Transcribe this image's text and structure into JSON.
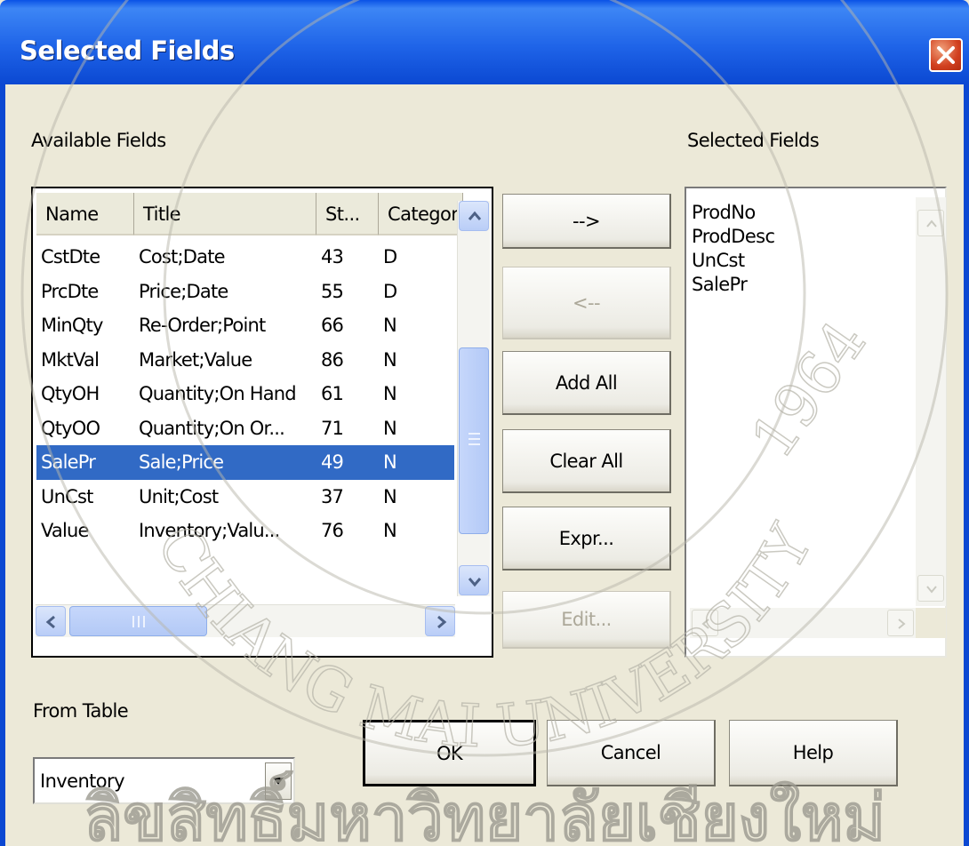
{
  "window": {
    "title": "Selected Fields"
  },
  "labels": {
    "available_fields": "Available Fields",
    "selected_fields": "Selected Fields",
    "from_table": "From Table"
  },
  "available_fields": {
    "columns": [
      "Name",
      "Title",
      "St...",
      "Category"
    ],
    "rows": [
      {
        "name": "CstDte",
        "title": "Cost;Date",
        "st": "43",
        "category": "D"
      },
      {
        "name": "PrcDte",
        "title": "Price;Date",
        "st": "55",
        "category": "D"
      },
      {
        "name": "MinQty",
        "title": "Re-Order;Point",
        "st": "66",
        "category": "N"
      },
      {
        "name": "MktVal",
        "title": "Market;Value",
        "st": "86",
        "category": "N"
      },
      {
        "name": "QtyOH",
        "title": "Quantity;On Hand",
        "st": "61",
        "category": "N"
      },
      {
        "name": "QtyOO",
        "title": "Quantity;On Or...",
        "st": "71",
        "category": "N"
      },
      {
        "name": "SalePr",
        "title": "Sale;Price",
        "st": "49",
        "category": "N"
      },
      {
        "name": "UnCst",
        "title": "Unit;Cost",
        "st": "37",
        "category": "N"
      },
      {
        "name": "Value",
        "title": "Inventory;Valu...",
        "st": "76",
        "category": "N"
      }
    ],
    "selected_row": "SalePr"
  },
  "move_buttons": {
    "add": "-->",
    "remove": "<--",
    "add_all": "Add All",
    "clear_all": "Clear All",
    "expr": "Expr...",
    "edit": "Edit..."
  },
  "selected_fields": [
    "ProdNo",
    "ProdDesc",
    "UnCst",
    "SalePr"
  ],
  "from_table": {
    "value": "Inventory"
  },
  "dialog_buttons": {
    "ok": "OK",
    "cancel": "Cancel",
    "help": "Help"
  },
  "watermark": {
    "arc_text": "CHIANG MAI UNIVERSITY",
    "year": "1964",
    "bottom_text": "ลิขสิทธิ์มหาวิทยาลัยเชียงใหม่"
  },
  "colors": {
    "title_bar": "#1f64e8",
    "selection": "#316ac5",
    "dialog_bg": "#ece9d8"
  }
}
